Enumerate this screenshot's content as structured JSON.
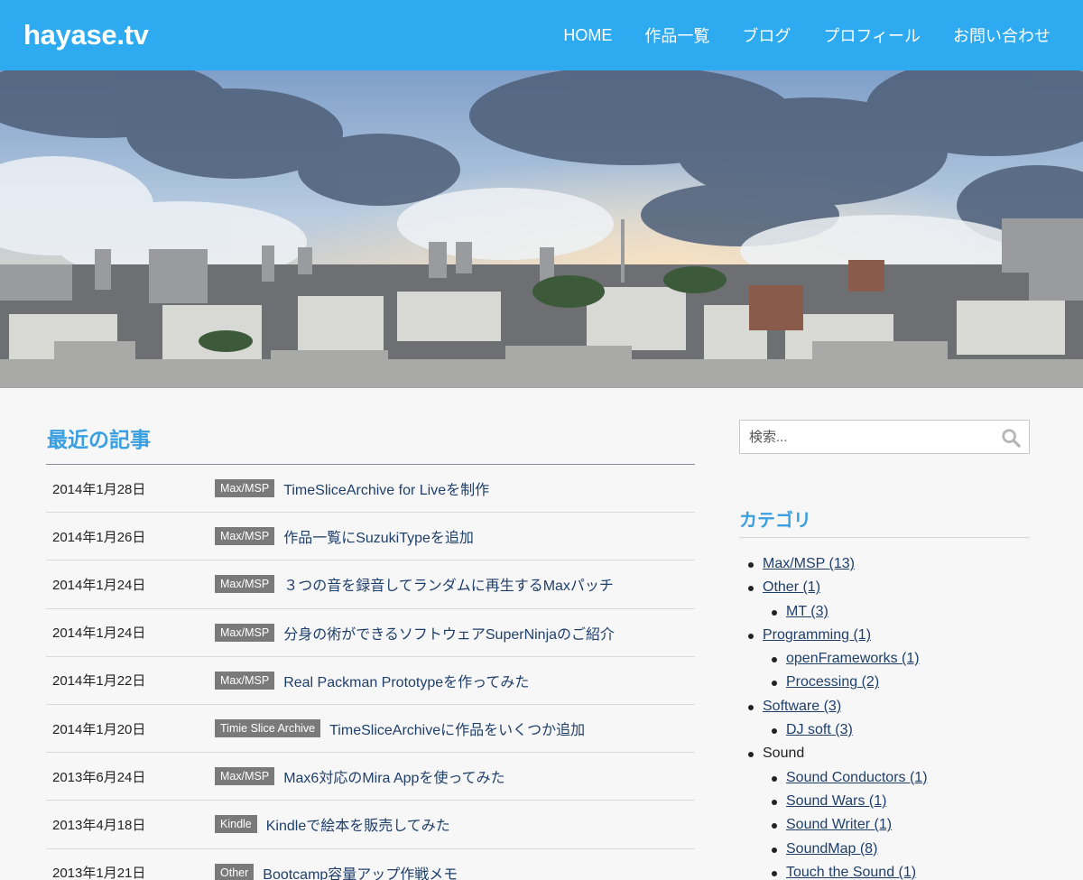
{
  "site": {
    "logo": "hayase.tv"
  },
  "nav": {
    "items": [
      {
        "label": "HOME"
      },
      {
        "label": "作品一覧"
      },
      {
        "label": "ブログ"
      },
      {
        "label": "プロフィール"
      },
      {
        "label": "お問い合わせ"
      }
    ]
  },
  "main": {
    "section_title": "最近の記事",
    "posts": [
      {
        "date": "2014年1月28日",
        "tag": "Max/MSP",
        "title": "TimeSliceArchive for Liveを制作"
      },
      {
        "date": "2014年1月26日",
        "tag": "Max/MSP",
        "title": "作品一覧にSuzukiTypeを追加"
      },
      {
        "date": "2014年1月24日",
        "tag": "Max/MSP",
        "title": "３つの音を録音してランダムに再生するMaxパッチ"
      },
      {
        "date": "2014年1月24日",
        "tag": "Max/MSP",
        "title": "分身の術ができるソフトウェアSuperNinjaのご紹介"
      },
      {
        "date": "2014年1月22日",
        "tag": "Max/MSP",
        "title": "Real Packman Prototypeを作ってみた"
      },
      {
        "date": "2014年1月20日",
        "tag": "Timie Slice Archive",
        "title": "TimeSliceArchiveに作品をいくつか追加"
      },
      {
        "date": "2013年6月24日",
        "tag": "Max/MSP",
        "title": "Max6対応のMira Appを使ってみた"
      },
      {
        "date": "2013年4月18日",
        "tag": "Kindle",
        "title": "Kindleで絵本を販売してみた"
      },
      {
        "date": "2013年1月21日",
        "tag": "Other",
        "title": "Bootcamp容量アップ作戦メモ"
      }
    ]
  },
  "sidebar": {
    "search_placeholder": "検索...",
    "categories_title": "カテゴリ",
    "categories": [
      {
        "label": "Max/MSP (13)",
        "level": 1,
        "link": true
      },
      {
        "label": "Other (1)",
        "level": 1,
        "link": true
      },
      {
        "label": "MT (3)",
        "level": 2,
        "link": true
      },
      {
        "label": "Programming (1)",
        "level": 1,
        "link": true
      },
      {
        "label": "openFrameworks (1)",
        "level": 2,
        "link": true
      },
      {
        "label": "Processing (2)",
        "level": 2,
        "link": true
      },
      {
        "label": "Software (3)",
        "level": 1,
        "link": true
      },
      {
        "label": "DJ soft (3)",
        "level": 2,
        "link": true
      },
      {
        "label": "Sound",
        "level": 1,
        "link": false
      },
      {
        "label": "Sound Conductors (1)",
        "level": 2,
        "link": true
      },
      {
        "label": "Sound Wars (1)",
        "level": 2,
        "link": true
      },
      {
        "label": "Sound Writer (1)",
        "level": 2,
        "link": true
      },
      {
        "label": "SoundMap (8)",
        "level": 2,
        "link": true
      },
      {
        "label": "Touch the Sound (1)",
        "level": 2,
        "link": true
      }
    ]
  },
  "colors": {
    "header_bg": "#2eaaf1",
    "accent": "#3a9fe0",
    "tag_bg": "#7a7a7a",
    "link": "#1f3f6b"
  }
}
